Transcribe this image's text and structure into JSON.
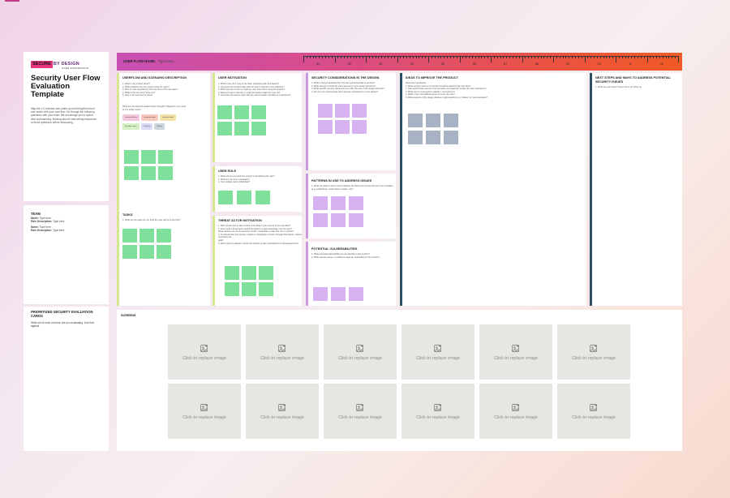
{
  "brand": {
    "mark": "SECURE",
    "rest": "BY DESIGN",
    "sub": "USER EXPERIENCE"
  },
  "sidebar": {
    "title": "Security User Flow Evaluation Template",
    "description": "Map the 1-5 relevant user paths up and bring them front and center with your user flow. Go through the following questions with your team. We encourage you to spend time summarizing, thinking about it and writing responses to these questions before discussing.",
    "team": {
      "heading": "TEAM",
      "members": [
        {
          "name_label": "Name:",
          "name": "Type here",
          "role_label": "Role Description:",
          "role": "Type here"
        },
        {
          "name_label": "Name:",
          "name": "Type here",
          "role_label": "Role Description:",
          "role": "Type here"
        }
      ]
    },
    "prioritized": {
      "heading": "PRIORITIZED SECURITY EVALUATION CARDS",
      "text": "Write out of most common are you evaluating. Use flow against"
    }
  },
  "header": {
    "label": "USER FLOW NAME:",
    "placeholder": "Type here...",
    "ruler": [
      "01",
      "02",
      "03",
      "04",
      "05",
      "06",
      "07",
      "08",
      "09",
      "10",
      "11",
      "12"
    ]
  },
  "sections": {
    "userflow": {
      "title": "USERFLOW AND SCENARIO DESCRIPTION",
      "questions": [
        "1. What is the product about?",
        "2. What problems are we trying to solve for users?",
        "3. Who is most impacted by this user flow or this use case?",
        "4. What is the user flow? How is it?",
        "5. How is the user flow of steps?"
      ],
      "hint": "What are the steps the feature flows through? Categorize your steps on the sticky notes?",
      "pills": [
        "Scenario Starts",
        "Scenario Steps",
        "Scenario Ends",
        "Possible errors",
        "Criticality",
        "Rating"
      ]
    },
    "tasks": {
      "title": "TASKS",
      "questions": [
        "1. What are the tasks do you think the user will do in this flow?"
      ]
    },
    "motivation": {
      "title": "USER MOTIVATION",
      "questions": [
        "1. What is the user trying to do when interacting with this feature?",
        "2. How does the product align with the user's original or core objective?",
        "3. What security concerns might the user have when using this feature?",
        "4. Relevant user's intention or goals the feature helps the user do?",
        "5. How does the feature align with the user's broader workflow or experience?"
      ]
    },
    "role": {
      "title": "USER ROLE",
      "questions": [
        "1. What role do you think the product is describing this user?",
        "2. What are the user's privileges?",
        "3. Can multiple users collaborate?"
      ]
    },
    "threat": {
      "title": "THREAT ACTOR MOTIVATION",
      "questions": [
        "1. Who would want to take control of the data or gain access to the user flow?",
        "2. How could a threat actor exploit the feature to gain advantage over the user?",
        "   What controls can the threat actor predict, manipulate or alter this user's actions?",
        "3. If a threat actor can access, exploit or manipulate a system through this feature, what is most likely the",
        "   goal?",
        "4. How might an attacker misuse this feature to gain unauthorized or elevated access?"
      ]
    },
    "security": {
      "title": "SECURITY CONSIDERATIONS IN THE DESIGN",
      "questions": [
        "1. What is being requested from the user (personal data or access)?",
        "2. What security controls do you implement in your design elements?",
        "3. What specific security features do you offer the user in this design element?",
        "4. Are you not implementing other security mechanisms in your design?"
      ]
    },
    "patterns": {
      "title": "PATTERNS IN USE TO ADDRESS ISSUES",
      "questions": [
        "1. What UX patterns are in use to address the flows and prevent the user from mistakes (e.g. notifications, confirmation modals, etc)?"
      ]
    },
    "vulnerabilities": {
      "title": "POTENTIAL VULNERABILITIES",
      "questions": [
        "1. What potential vulnerabilities do you identify in this product?",
        "2. What security issues or problems might be exploitable for the product?"
      ]
    },
    "ideas": {
      "title": "IDEAS TO IMPROVE THE PRODUCT",
      "questions": [
        "Discussion Questions:",
        "1. What security options or controls should be added to the user flow?",
        "2. How would these security improvements not negatively impact the user experience?",
        "3. What can be improved for usability / convenience?",
        "4. What is the most difficult aspect to move the user?",
        "5. What aspects of this design decision might benefit from a \"delete\" in future iterations?"
      ]
    },
    "next": {
      "title": "NEXT STEPS AND WAYS TO ADDRESS POTENTIAL SECURITY ISSUES",
      "questions": [
        "1. What are next steps? Action items for follow up"
      ]
    }
  },
  "screens": {
    "title": "SCREENS",
    "placeholder": "Click to replace image"
  },
  "colors": {
    "lime": "#d4e98b",
    "purple": "#c99ae2",
    "teal": "#2d4f63",
    "green_sticky": "#7ee09a",
    "purple_sticky": "#d7b2f0",
    "gray_sticky": "#a7b3c4"
  }
}
